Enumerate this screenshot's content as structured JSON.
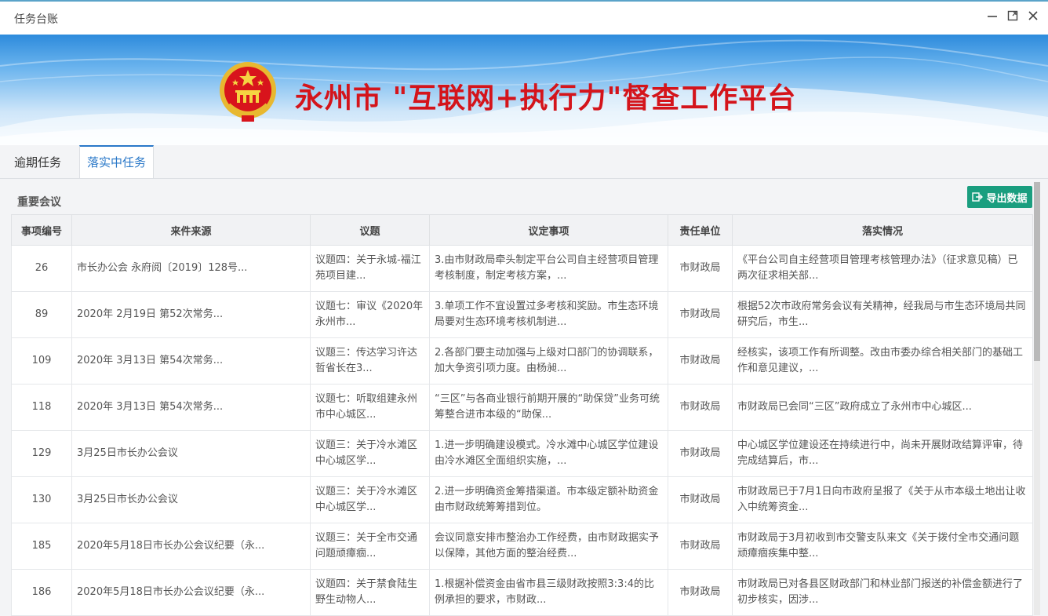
{
  "window": {
    "title": "任务台账"
  },
  "banner": {
    "title": "永州市 \"互联网+执行力\"督查工作平台"
  },
  "tabs": [
    {
      "label": "逾期任务",
      "active": false
    },
    {
      "label": "落实中任务",
      "active": true
    }
  ],
  "section": {
    "title": "重要会议"
  },
  "toolbar": {
    "export_label": "导出数据"
  },
  "table": {
    "columns": [
      "事项编号",
      "来件来源",
      "议题",
      "议定事项",
      "责任单位",
      "落实情况"
    ],
    "rows": [
      {
        "id": "26",
        "source": "市长办公会 永府阅〔2019〕128号...",
        "topic": "议题四：关于永城-福江苑项目建...",
        "item": "3.由市财政局牵头制定平台公司自主经营项目管理考核制度，制定考核方案，...",
        "unit": "市财政局",
        "status": "《平台公司自主经营项目管理考核管理办法》（征求意见稿）已两次征求相关部..."
      },
      {
        "id": "89",
        "source": "2020年 2月19日 第52次常务...",
        "topic": "议题七：审议《2020年永州市...",
        "item": "3.单项工作不宜设置过多考核和奖励。市生态环境局要对生态环境考核机制进...",
        "unit": "市财政局",
        "status": "根据52次市政府常务会议有关精神，经我局与市生态环境局共同研究后，市生..."
      },
      {
        "id": "109",
        "source": "2020年 3月13日 第54次常务...",
        "topic": "议题三：传达学习许达哲省长在3...",
        "item": "2.各部门要主动加强与上级对口部门的协调联系，加大争资引项力度。由杨昶...",
        "unit": "市财政局",
        "status": "经核实，该项工作有所调整。改由市委办综合相关部门的基础工作和意见建议，..."
      },
      {
        "id": "118",
        "source": "2020年 3月13日 第54次常务...",
        "topic": "议题七：听取组建永州市中心城区...",
        "item": "“三区”与各商业银行前期开展的“助保贷”业务可统筹整合进市本级的“助保...",
        "unit": "市财政局",
        "status": "市财政局已会同“三区”政府成立了永州市中心城区..."
      },
      {
        "id": "129",
        "source": "3月25日市长办公会议",
        "topic": "议题三：关于冷水滩区中心城区学...",
        "item": "1.进一步明确建设模式。冷水滩中心城区学位建设由冷水滩区全面组织实施，...",
        "unit": "市财政局",
        "status": "中心城区学位建设还在持续进行中，尚未开展财政结算评审，待完成结算后，市..."
      },
      {
        "id": "130",
        "source": "3月25日市长办公会议",
        "topic": "议题三：关于冷水滩区中心城区学...",
        "item": "2.进一步明确资金筹措渠道。市本级定额补助资金由市财政统筹筹措到位。",
        "unit": "市财政局",
        "status": "市财政局已于7月1日向市政府呈报了《关于从市本级土地出让收入中统筹资金..."
      },
      {
        "id": "185",
        "source": "2020年5月18日市长办公会议纪要（永...",
        "topic": "议题三：关于全市交通问题顽瘴痼...",
        "item": "会议同意安排市整治办工作经费，由市财政据实予以保障，其他方面的整治经费...",
        "unit": "市财政局",
        "status": "市财政局于3月初收到市交警支队来文《关于拨付全市交通问题顽瘴痼疾集中整..."
      },
      {
        "id": "186",
        "source": "2020年5月18日市长办公会议纪要（永...",
        "topic": "议题四：关于禁食陆生野生动物人...",
        "item": "1.根据补偿资金由省市县三级财政按照3:3:4的比例承担的要求，市财政...",
        "unit": "市财政局",
        "status": "市财政局已对各县区财政部门和林业部门报送的补偿金额进行了初步核实，因涉..."
      }
    ]
  },
  "colors": {
    "accent": "#2a78c8",
    "export_button": "#1a9e7f",
    "banner_title": "#d4141b"
  }
}
